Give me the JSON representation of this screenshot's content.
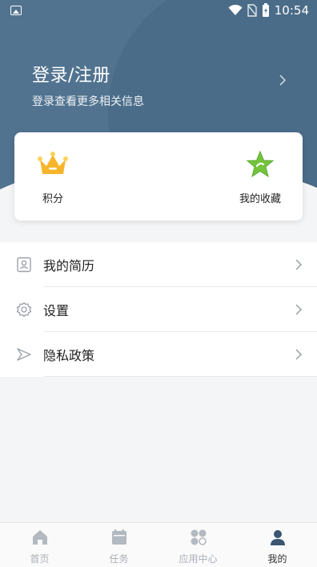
{
  "status_bar": {
    "time": "10:54"
  },
  "profile": {
    "title": "登录/注册",
    "subtitle": "登录查看更多相关信息"
  },
  "card": {
    "points_label": "积分",
    "favorites_label": "我的收藏"
  },
  "menu": {
    "items": [
      {
        "label": "我的简历",
        "icon": "resume-icon"
      },
      {
        "label": "设置",
        "icon": "gear-icon"
      },
      {
        "label": "隐私政策",
        "icon": "privacy-icon"
      }
    ]
  },
  "tabbar": {
    "tabs": [
      {
        "label": "首页",
        "icon": "home-icon"
      },
      {
        "label": "任务",
        "icon": "calendar-icon"
      },
      {
        "label": "应用中心",
        "icon": "apps-icon"
      },
      {
        "label": "我的",
        "icon": "user-icon",
        "active": true
      }
    ]
  },
  "colors": {
    "header": "#51738f",
    "accent_gold": "#f5b324",
    "accent_green": "#6bbf3a",
    "tab_active": "#333333",
    "tab_inactive": "#aab0b8"
  }
}
